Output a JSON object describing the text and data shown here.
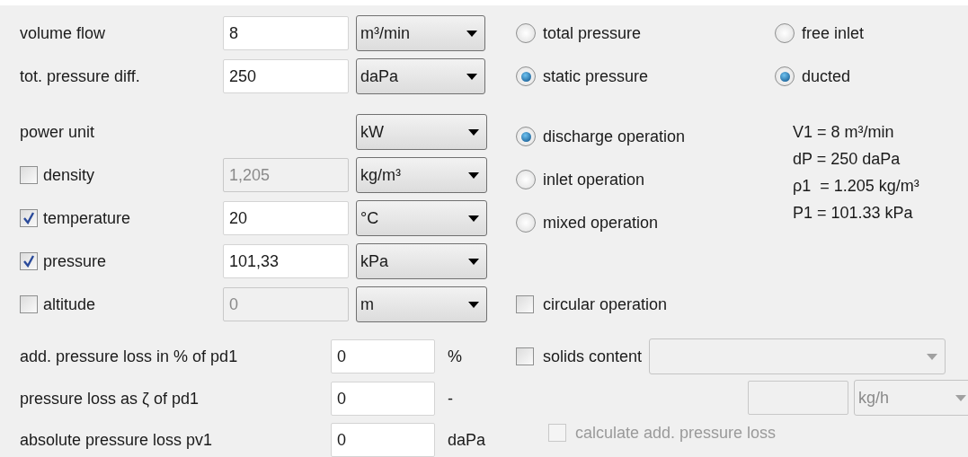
{
  "fields": [
    {
      "kind": "plain",
      "label": "volume flow",
      "value": "8",
      "unit": "m³/min"
    },
    {
      "kind": "plain",
      "label": "tot. pressure diff.",
      "value": "250",
      "unit": "daPa"
    },
    {
      "kind": "unit",
      "label": "power unit",
      "unit": "kW"
    },
    {
      "kind": "check",
      "label": "density",
      "checked": false,
      "value": "1,205",
      "unit": "kg/m³"
    },
    {
      "kind": "check",
      "label": "temperature",
      "checked": true,
      "value": "20",
      "unit": "°C"
    },
    {
      "kind": "check",
      "label": "pressure",
      "checked": true,
      "value": "101,33",
      "unit": "kPa"
    },
    {
      "kind": "check",
      "label": "altitude",
      "checked": false,
      "value": "0",
      "unit": "m"
    }
  ],
  "pressure_mode": [
    {
      "label": "total pressure",
      "selected": false
    },
    {
      "label": "static pressure",
      "selected": true
    }
  ],
  "inlet_mode": [
    {
      "label": "free inlet",
      "selected": false
    },
    {
      "label": "ducted",
      "selected": true
    }
  ],
  "operation_mode": [
    {
      "label": "discharge operation",
      "selected": true
    },
    {
      "label": "inlet operation",
      "selected": false
    },
    {
      "label": "mixed operation",
      "selected": false
    }
  ],
  "summary": [
    "V1 = 8 m³/min",
    "dP = 250 daPa",
    "ρ1  = 1.205 kg/m³",
    "P1 = 101.33 kPa"
  ],
  "circular": {
    "label": "circular operation",
    "checked": false
  },
  "losses": [
    {
      "label": "add. pressure loss in % of pd1",
      "value": "0",
      "unit": "%"
    },
    {
      "label": "pressure loss as ζ of pd1",
      "value": "0",
      "unit": "-"
    },
    {
      "label": "absolute pressure loss pv1",
      "value": "0",
      "unit": "daPa"
    }
  ],
  "solids": {
    "label": "solids content",
    "checked": false,
    "rate_unit": "kg/h"
  },
  "calculate": {
    "label": "calculate add. pressure loss",
    "checked": false,
    "disabled": true
  }
}
